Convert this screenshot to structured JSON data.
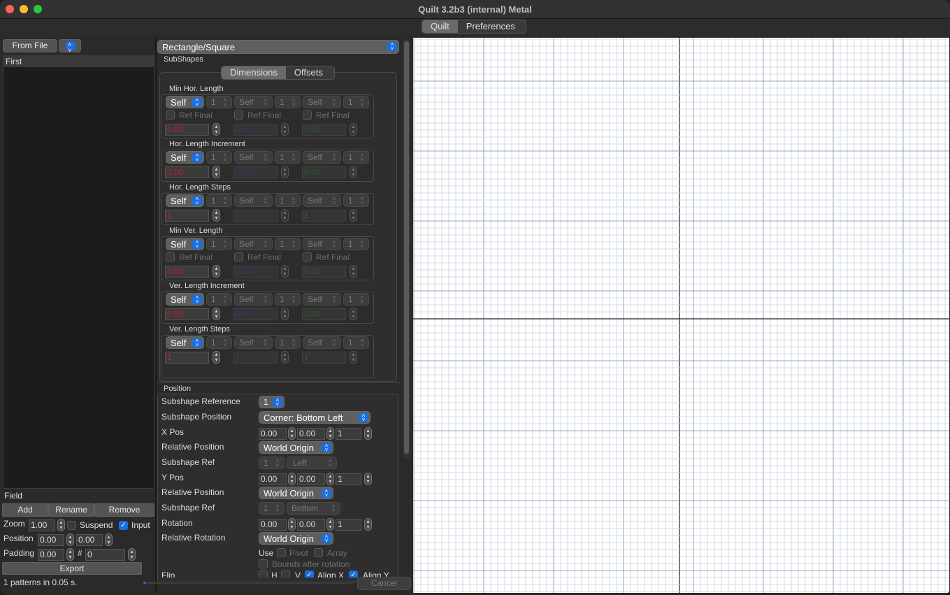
{
  "window": {
    "title": "Quilt 3.2b3 (internal) Metal"
  },
  "top_tabs": [
    {
      "label": "Quilt",
      "active": true
    },
    {
      "label": "Preferences",
      "active": false
    }
  ],
  "left": {
    "from_file_label": "From File",
    "list_header": "First",
    "field_label": "Field",
    "add_label": "Add",
    "rename_label": "Rename",
    "remove_label": "Remove",
    "zoom_label": "Zoom",
    "zoom_value": "1.00",
    "suspend_label": "Suspend",
    "suspend_checked": false,
    "input_label": "Input",
    "input_checked": true,
    "position_label": "Position",
    "position_x": "0.00",
    "position_y": "0.00",
    "padding_label": "Padding",
    "padding_value": "0.00",
    "hash_label": "#",
    "hash_value": "0",
    "export_label": "Export",
    "status": "1 patterns in 0.05 s."
  },
  "mid": {
    "shape_type": "Rectangle/Square",
    "subshapes_label": "SubShapes",
    "sub_tabs": [
      {
        "label": "Dimensions",
        "active": true
      },
      {
        "label": "Offsets",
        "active": false
      }
    ],
    "groups": {
      "g0": {
        "title": "Min Hor. Length",
        "ref": "Self",
        "one": "1",
        "ref_final": "Ref Final",
        "v1": "0.00",
        "v2": "0.00",
        "v3": "0.00"
      },
      "g1": {
        "title": "Hor. Length Increment",
        "ref": "Self",
        "one": "1",
        "v1": "0.00",
        "v2": "0.00",
        "v3": "0.00"
      },
      "g2": {
        "title": "Hor. Length Steps",
        "ref": "Self",
        "one": "1",
        "v1": "1",
        "v2": "1",
        "v3": "1"
      },
      "g3": {
        "title": "Min Ver. Length",
        "ref": "Self",
        "one": "1",
        "ref_final": "Ref Final",
        "v1": "0.00",
        "v2": "0.00",
        "v3": "0.00"
      },
      "g4": {
        "title": "Ver. Length Increment",
        "ref": "Self",
        "one": "1",
        "v1": "0.00",
        "v2": "0.00",
        "v3": "0.00"
      },
      "g5": {
        "title": "Ver. Length Steps",
        "ref": "Self",
        "one": "1",
        "v1": "1",
        "v2": "1",
        "v3": "1"
      }
    },
    "position": {
      "section_label": "Position",
      "subshape_reference_label": "Subshape Reference",
      "subshape_reference_value": "1",
      "subshape_position_label": "Subshape Position",
      "subshape_position_value": "Corner: Bottom Left",
      "xpos_label": "X Pos",
      "xpos_a": "0.00",
      "xpos_b": "0.00",
      "xpos_c": "1",
      "relpos1_label": "Relative Position",
      "relpos1_value": "World Origin",
      "subref1_label": "Subshape Ref",
      "subref1_num": "1",
      "subref1_side": "Left",
      "ypos_label": "Y Pos",
      "ypos_a": "0.00",
      "ypos_b": "0.00",
      "ypos_c": "1",
      "relpos2_label": "Relative Position",
      "relpos2_value": "World Origin",
      "subref2_label": "Subshape Ref",
      "subref2_num": "1",
      "subref2_side": "Bottom",
      "rotation_label": "Rotation",
      "rot_a": "0.00",
      "rot_b": "0.00",
      "rot_c": "1",
      "relrot_label": "Relative Rotation",
      "relrot_value": "World Origin",
      "use_label": "Use",
      "pivot_label": "Pivot",
      "array_label": "Array",
      "bounds_label": "Bounds after rotation",
      "flip_label": "Flip",
      "h_label": "H",
      "v_label": "V",
      "alignx_label": "Align X",
      "aligny_label": "Align Y"
    },
    "cancel_label": "Cancel"
  },
  "colors": {
    "red": "#c0202a",
    "blue": "#3040a0",
    "green": "#3a7a3a",
    "accent": "#1b6fe0"
  }
}
